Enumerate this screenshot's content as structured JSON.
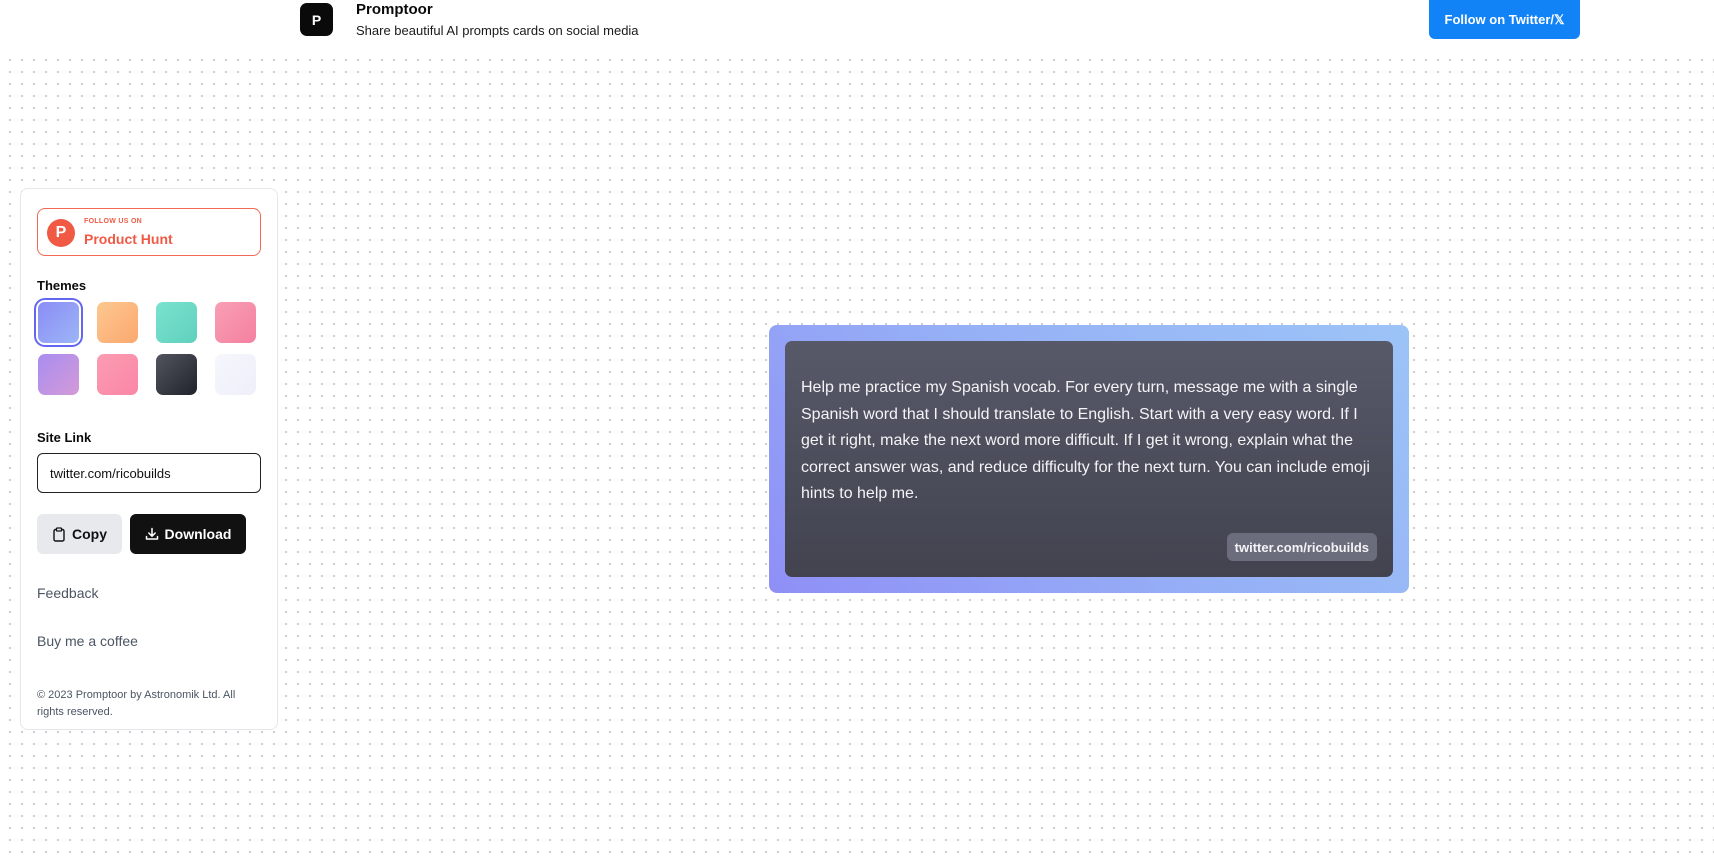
{
  "header": {
    "logo_letter": "P",
    "title": "Promptoor",
    "subtitle": "Share beautiful AI prompts cards on social media",
    "twitter_button": "Follow on Twitter/𝕏"
  },
  "sidebar": {
    "product_hunt": {
      "icon_letter": "P",
      "small": "FOLLOW US ON",
      "big": "Product Hunt"
    },
    "themes_label": "Themes",
    "themes": [
      {
        "name": "indigo",
        "colors": [
          "#8b8cf5",
          "#9cb6f7"
        ],
        "selected": true
      },
      {
        "name": "orange",
        "colors": [
          "#fcc891",
          "#fba86e"
        ],
        "selected": false
      },
      {
        "name": "teal",
        "colors": [
          "#7ae3cf",
          "#5fd0bd"
        ],
        "selected": false
      },
      {
        "name": "pink",
        "colors": [
          "#f99fb4",
          "#f480a0"
        ],
        "selected": false
      },
      {
        "name": "violet",
        "colors": [
          "#a88df0",
          "#d49ad8"
        ],
        "selected": false
      },
      {
        "name": "rose",
        "colors": [
          "#fb9cb1",
          "#fb86a6"
        ],
        "selected": false
      },
      {
        "name": "dark",
        "colors": [
          "#52555f",
          "#20232b"
        ],
        "selected": false
      },
      {
        "name": "white",
        "colors": [
          "#f6f6fc",
          "#eeeff9"
        ],
        "selected": false
      }
    ],
    "site_link_label": "Site Link",
    "site_link_value": "twitter.com/ricobuilds",
    "copy_button": "Copy",
    "download_button": "Download",
    "feedback": "Feedback",
    "coffee": "Buy me a coffee",
    "footer": "© 2023 Promptoor by Astronomik Ltd. All rights reserved."
  },
  "card": {
    "text": "Help me practice my Spanish vocab. For every turn, message me with a single Spanish word that I should translate to English. Start with a very easy word. If I get it right, make the next word more difficult. If I get it wrong, explain what the correct answer was, and reduce difficulty for the next turn. You can include emoji hints to help me.",
    "link": "twitter.com/ricobuilds"
  },
  "colors": {
    "accent": "#1283f6",
    "product_hunt": "#f05a45",
    "selected_ring": "#6366f1"
  }
}
